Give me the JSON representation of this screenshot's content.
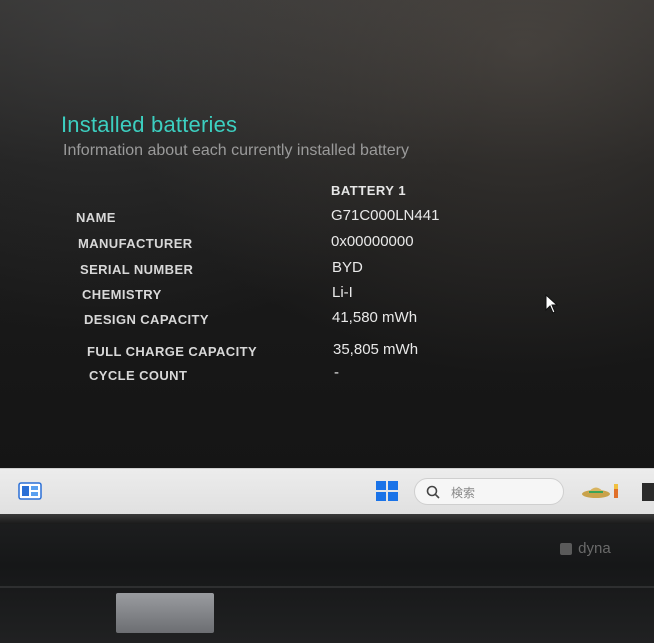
{
  "page": {
    "title": "Installed batteries",
    "subtitle": "Information about each currently installed battery"
  },
  "table": {
    "column_header": "BATTERY 1",
    "rows": [
      {
        "label": "NAME",
        "value": "G71C000LN441"
      },
      {
        "label": "MANUFACTURER",
        "value": "0x00000000"
      },
      {
        "label": "SERIAL NUMBER",
        "value": "BYD"
      },
      {
        "label": "CHEMISTRY",
        "value": "Li-I"
      },
      {
        "label": "DESIGN CAPACITY",
        "value": "41,580 mWh"
      },
      {
        "label": "FULL CHARGE CAPACITY",
        "value": "35,805 mWh"
      },
      {
        "label": "CYCLE COUNT",
        "value": "-"
      }
    ]
  },
  "taskbar": {
    "search_placeholder": "検索",
    "icons": [
      "widgets-icon",
      "windows-start-icon",
      "search-icon",
      "weather-icon"
    ]
  },
  "device": {
    "brand_text": "dyna"
  },
  "colors": {
    "accent": "#3ccfc0",
    "text_primary": "#e9e9e9",
    "text_secondary": "#9a9a9a",
    "taskbar_bg": "#e6e6e6",
    "start_blue": "#1a73e8"
  }
}
